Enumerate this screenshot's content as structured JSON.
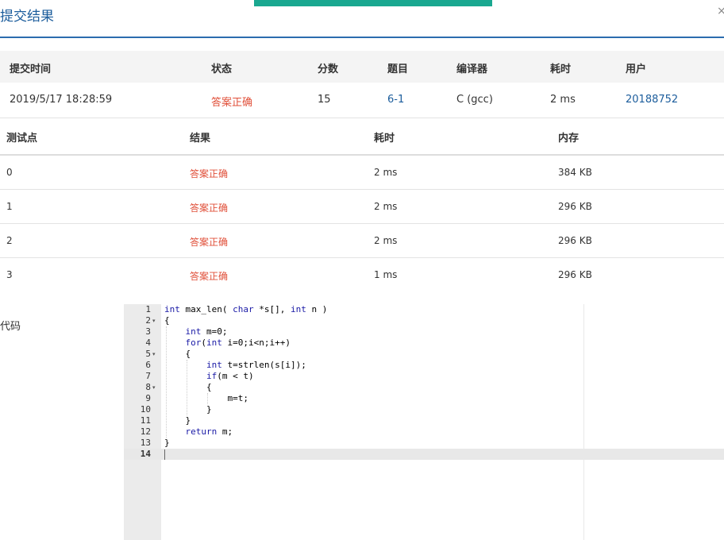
{
  "dialog": {
    "title": "提交结果",
    "close_label": "×"
  },
  "summary": {
    "headers": [
      "提交时间",
      "状态",
      "分数",
      "题目",
      "编译器",
      "耗时",
      "用户"
    ],
    "row": {
      "time": "2019/5/17 18:28:59",
      "status": "答案正确",
      "score": "15",
      "problem": "6-1",
      "compiler": "C (gcc)",
      "elapsed": "2 ms",
      "user": "20188752"
    }
  },
  "testcases": {
    "headers": [
      "测试点",
      "结果",
      "耗时",
      "内存"
    ],
    "rows": [
      {
        "id": "0",
        "result": "答案正确",
        "time": "2 ms",
        "memory": "384 KB"
      },
      {
        "id": "1",
        "result": "答案正确",
        "time": "2 ms",
        "memory": "296 KB"
      },
      {
        "id": "2",
        "result": "答案正确",
        "time": "2 ms",
        "memory": "296 KB"
      },
      {
        "id": "3",
        "result": "答案正确",
        "time": "1 ms",
        "memory": "296 KB"
      }
    ]
  },
  "code_section": {
    "label": "代码",
    "lines": [
      "int max_len( char *s[], int n )",
      "{",
      "    int m=0;",
      "    for(int i=0;i<n;i++)",
      "    {",
      "        int t=strlen(s[i]);",
      "        if(m < t)",
      "        {",
      "            m=t;",
      "        }",
      "    }",
      "    return m;",
      "}",
      ""
    ],
    "line_numbers": [
      "1",
      "2",
      "3",
      "4",
      "5",
      "6",
      "7",
      "8",
      "9",
      "10",
      "11",
      "12",
      "13",
      "14"
    ],
    "fold_markers": {
      "2": "▾",
      "5": "▾",
      "8": "▾"
    }
  },
  "colors": {
    "accent": "#1aa890",
    "link": "#1c5d9c",
    "status_ok": "#e0503a"
  }
}
